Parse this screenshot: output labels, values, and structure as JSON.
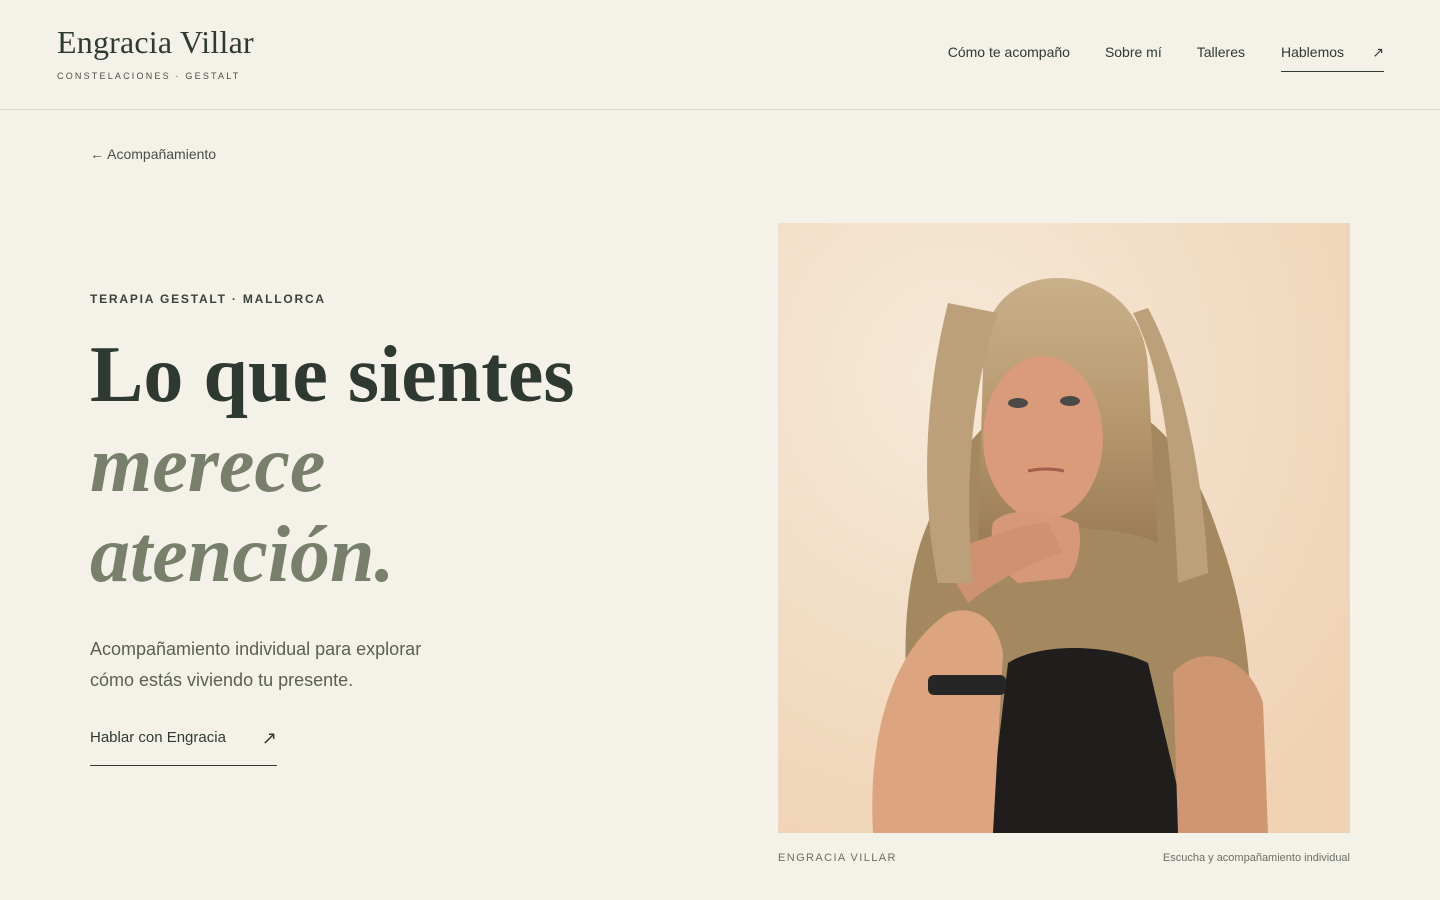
{
  "brand": {
    "name": "Engracia Villar",
    "tagline": "CONSTELACIONES · GESTALT"
  },
  "nav": {
    "items": [
      {
        "label": "Cómo te acompaño"
      },
      {
        "label": "Sobre mí"
      },
      {
        "label": "Talleres"
      }
    ],
    "cta_label": "Hablemos",
    "cta_icon": "↗"
  },
  "back_link": "← Acompañamiento",
  "hero": {
    "eyebrow": "TERAPIA GESTALT · MALLORCA",
    "headline_line1": "Lo que sientes",
    "headline_line2": "merece",
    "headline_line3": "atención.",
    "intro": "Acompañamiento individual para explorar cómo estás viviendo tu presente.",
    "cta_label": "Hablar con Engracia",
    "cta_icon": "↗"
  },
  "photo": {
    "caption_left": "ENGRACIA VILLAR",
    "caption_right": "Escucha y acompañamiento individual"
  },
  "colors": {
    "background": "#f4f1e8",
    "text_dark": "#2e3a31",
    "accent_sage": "#78806b",
    "divider": "#dcd8cc"
  }
}
